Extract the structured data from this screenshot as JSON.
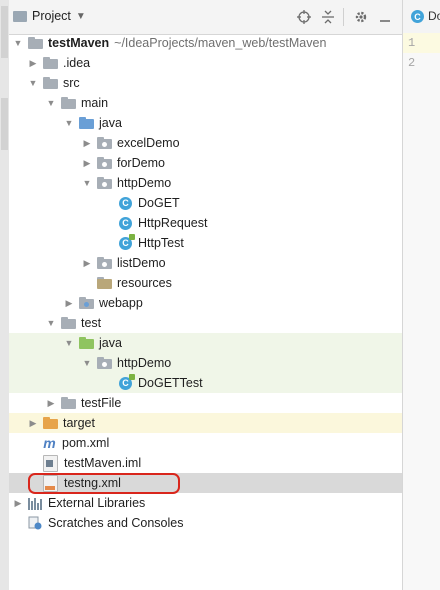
{
  "panel": {
    "title": "Project",
    "toolbar_icons": [
      "target-icon",
      "collapse-icon",
      "gear-icon",
      "hide-icon"
    ]
  },
  "editor": {
    "tab_label": "Do",
    "line_numbers": [
      "1",
      "2"
    ]
  },
  "tree": {
    "root_name": "testMaven",
    "root_path": "~/IdeaProjects/maven_web/testMaven",
    "idea": ".idea",
    "src": "src",
    "main": "main",
    "java_main": "java",
    "excelDemo": "excelDemo",
    "forDemo": "forDemo",
    "httpDemo": "httpDemo",
    "DoGET": "DoGET",
    "HttpRequest": "HttpRequest",
    "HttpTest": "HttpTest",
    "listDemo": "listDemo",
    "resources": "resources",
    "webapp": "webapp",
    "test": "test",
    "java_test": "java",
    "httpDemo_test": "httpDemo",
    "DoGETTest": "DoGETTest",
    "testFile": "testFile",
    "target": "target",
    "pom": "pom.xml",
    "iml": "testMaven.iml",
    "testng": "testng.xml",
    "ext_libs": "External Libraries",
    "scratches": "Scratches and Consoles"
  },
  "colors": {
    "highlight_ring": "#d9261c",
    "test_row_bg": "#f0f6e8",
    "target_row_bg": "#fbf7dc",
    "selected_row_bg": "#d9d9d9"
  }
}
